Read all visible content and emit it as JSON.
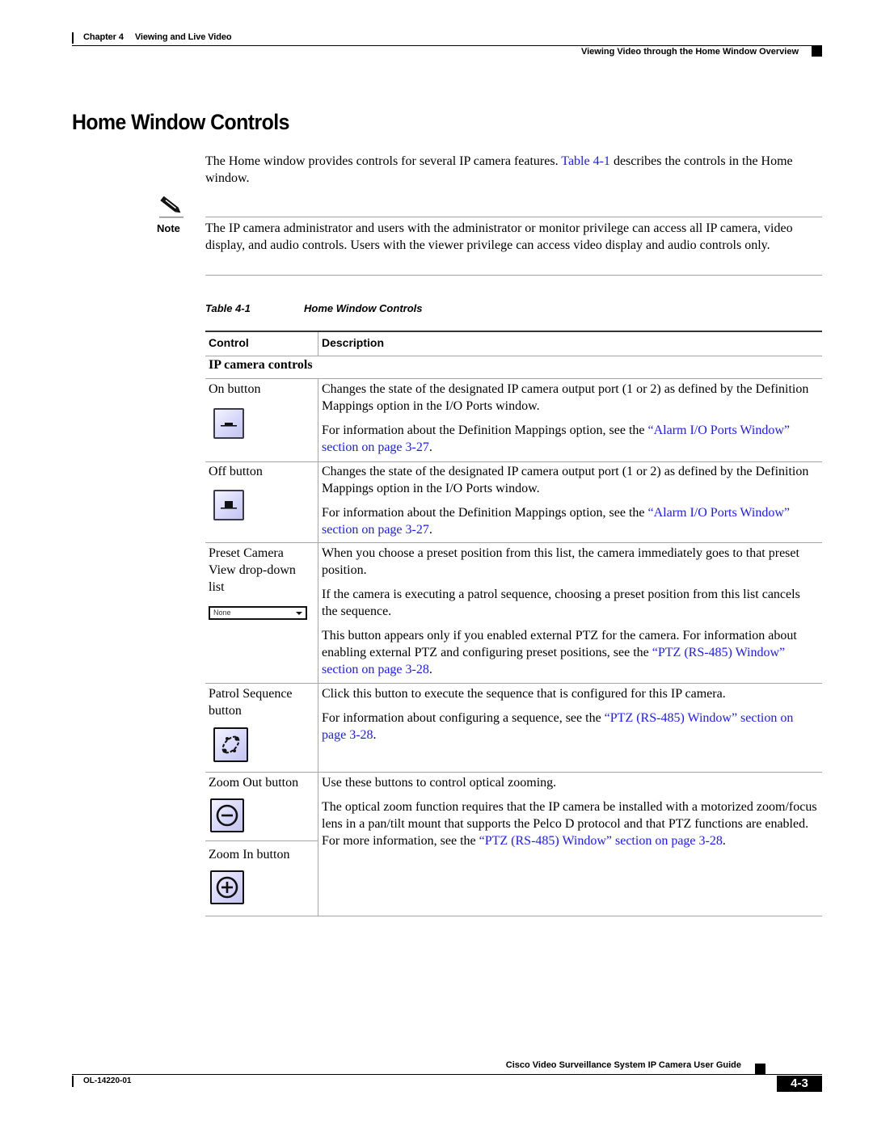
{
  "header": {
    "chapter_label": "Chapter 4",
    "chapter_title": "Viewing and Live Video",
    "section_title": "Viewing Video through the Home Window Overview"
  },
  "page_title": "Home Window Controls",
  "intro": {
    "text_before": "The Home window provides controls for several IP camera features. ",
    "link": "Table 4-1",
    "text_after": " describes the controls in the Home window."
  },
  "note": {
    "label": "Note",
    "icon": "pencil-icon",
    "text": "The IP camera administrator and users with the administrator or monitor privilege can access all IP camera, video display, and audio controls. Users with the viewer privilege can access video display and audio controls only."
  },
  "table": {
    "caption_number": "Table 4-1",
    "caption_title": "Home Window Controls",
    "columns": [
      "Control",
      "Description"
    ],
    "group_title": "IP camera controls",
    "rows": [
      {
        "control": "On button",
        "icon": "on-button-icon",
        "desc1": "Changes the state of the designated IP camera output port (1 or 2) as defined by the Definition Mappings option in the I/O Ports window.",
        "desc2_before": "For information about the Definition Mappings option, see the ",
        "desc2_link": "“Alarm I/O Ports Window” section on page 3-27",
        "desc2_after": "."
      },
      {
        "control": "Off button",
        "icon": "off-button-icon",
        "desc1": "Changes the state of the designated IP camera output port (1 or 2) as defined by the Definition Mappings option in the I/O Ports window.",
        "desc2_before": "For information about the Definition Mappings option, see the ",
        "desc2_link": "“Alarm I/O Ports Window” section on page 3-27",
        "desc2_after": "."
      },
      {
        "control": "Preset Camera View drop-down list",
        "dropdown_value": "None",
        "desc1": "When you choose a preset position from this list, the camera immediately goes to that preset position.",
        "desc2": "If the camera is executing a patrol sequence, choosing a preset position from this list cancels the sequence.",
        "desc3_before": "This button appears only if you enabled external PTZ for the camera. For information about enabling external PTZ and configuring preset positions, see the ",
        "desc3_link": "“PTZ (RS-485) Window” section on page 3-28",
        "desc3_after": "."
      },
      {
        "control": "Patrol Sequence button",
        "icon": "patrol-sequence-icon",
        "desc1": "Click this button to execute the sequence that is configured for this IP camera.",
        "desc2_before": "For information about configuring a sequence, see the ",
        "desc2_link": "“PTZ (RS-485) Window” section on page 3-28",
        "desc2_after": "."
      },
      {
        "control_a": "Zoom Out button",
        "icon_a": "zoom-out-icon",
        "control_b": "Zoom In button",
        "icon_b": "zoom-in-icon",
        "desc1": "Use these buttons to control optical zooming.",
        "desc2_before": "The optical zoom function requires that the IP camera be installed with a motorized zoom/focus lens in a pan/tilt mount that supports the Pelco D protocol and that PTZ functions are enabled. For more information, see the ",
        "desc2_link": "“PTZ (RS-485) Window” section on page 3-28",
        "desc2_after": "."
      }
    ]
  },
  "footer": {
    "guide_title": "Cisco Video Surveillance System IP Camera User Guide",
    "doc_number": "OL-14220-01",
    "page_number": "4-3"
  },
  "colors": {
    "link": "#1a1aff",
    "rule": "#a6a6a6",
    "text": "#000000"
  }
}
